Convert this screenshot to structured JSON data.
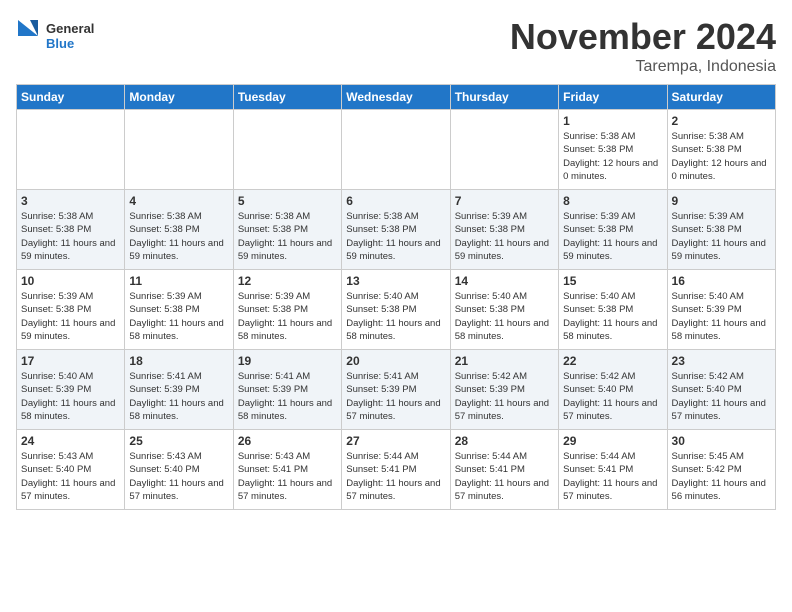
{
  "header": {
    "logo_line1": "General",
    "logo_line2": "Blue",
    "month_title": "November 2024",
    "location": "Tarempa, Indonesia"
  },
  "days_of_week": [
    "Sunday",
    "Monday",
    "Tuesday",
    "Wednesday",
    "Thursday",
    "Friday",
    "Saturday"
  ],
  "weeks": [
    [
      {
        "day": "",
        "info": ""
      },
      {
        "day": "",
        "info": ""
      },
      {
        "day": "",
        "info": ""
      },
      {
        "day": "",
        "info": ""
      },
      {
        "day": "",
        "info": ""
      },
      {
        "day": "1",
        "info": "Sunrise: 5:38 AM\nSunset: 5:38 PM\nDaylight: 12 hours and 0 minutes."
      },
      {
        "day": "2",
        "info": "Sunrise: 5:38 AM\nSunset: 5:38 PM\nDaylight: 12 hours and 0 minutes."
      }
    ],
    [
      {
        "day": "3",
        "info": "Sunrise: 5:38 AM\nSunset: 5:38 PM\nDaylight: 11 hours and 59 minutes."
      },
      {
        "day": "4",
        "info": "Sunrise: 5:38 AM\nSunset: 5:38 PM\nDaylight: 11 hours and 59 minutes."
      },
      {
        "day": "5",
        "info": "Sunrise: 5:38 AM\nSunset: 5:38 PM\nDaylight: 11 hours and 59 minutes."
      },
      {
        "day": "6",
        "info": "Sunrise: 5:38 AM\nSunset: 5:38 PM\nDaylight: 11 hours and 59 minutes."
      },
      {
        "day": "7",
        "info": "Sunrise: 5:39 AM\nSunset: 5:38 PM\nDaylight: 11 hours and 59 minutes."
      },
      {
        "day": "8",
        "info": "Sunrise: 5:39 AM\nSunset: 5:38 PM\nDaylight: 11 hours and 59 minutes."
      },
      {
        "day": "9",
        "info": "Sunrise: 5:39 AM\nSunset: 5:38 PM\nDaylight: 11 hours and 59 minutes."
      }
    ],
    [
      {
        "day": "10",
        "info": "Sunrise: 5:39 AM\nSunset: 5:38 PM\nDaylight: 11 hours and 59 minutes."
      },
      {
        "day": "11",
        "info": "Sunrise: 5:39 AM\nSunset: 5:38 PM\nDaylight: 11 hours and 58 minutes."
      },
      {
        "day": "12",
        "info": "Sunrise: 5:39 AM\nSunset: 5:38 PM\nDaylight: 11 hours and 58 minutes."
      },
      {
        "day": "13",
        "info": "Sunrise: 5:40 AM\nSunset: 5:38 PM\nDaylight: 11 hours and 58 minutes."
      },
      {
        "day": "14",
        "info": "Sunrise: 5:40 AM\nSunset: 5:38 PM\nDaylight: 11 hours and 58 minutes."
      },
      {
        "day": "15",
        "info": "Sunrise: 5:40 AM\nSunset: 5:38 PM\nDaylight: 11 hours and 58 minutes."
      },
      {
        "day": "16",
        "info": "Sunrise: 5:40 AM\nSunset: 5:39 PM\nDaylight: 11 hours and 58 minutes."
      }
    ],
    [
      {
        "day": "17",
        "info": "Sunrise: 5:40 AM\nSunset: 5:39 PM\nDaylight: 11 hours and 58 minutes."
      },
      {
        "day": "18",
        "info": "Sunrise: 5:41 AM\nSunset: 5:39 PM\nDaylight: 11 hours and 58 minutes."
      },
      {
        "day": "19",
        "info": "Sunrise: 5:41 AM\nSunset: 5:39 PM\nDaylight: 11 hours and 58 minutes."
      },
      {
        "day": "20",
        "info": "Sunrise: 5:41 AM\nSunset: 5:39 PM\nDaylight: 11 hours and 57 minutes."
      },
      {
        "day": "21",
        "info": "Sunrise: 5:42 AM\nSunset: 5:39 PM\nDaylight: 11 hours and 57 minutes."
      },
      {
        "day": "22",
        "info": "Sunrise: 5:42 AM\nSunset: 5:40 PM\nDaylight: 11 hours and 57 minutes."
      },
      {
        "day": "23",
        "info": "Sunrise: 5:42 AM\nSunset: 5:40 PM\nDaylight: 11 hours and 57 minutes."
      }
    ],
    [
      {
        "day": "24",
        "info": "Sunrise: 5:43 AM\nSunset: 5:40 PM\nDaylight: 11 hours and 57 minutes."
      },
      {
        "day": "25",
        "info": "Sunrise: 5:43 AM\nSunset: 5:40 PM\nDaylight: 11 hours and 57 minutes."
      },
      {
        "day": "26",
        "info": "Sunrise: 5:43 AM\nSunset: 5:41 PM\nDaylight: 11 hours and 57 minutes."
      },
      {
        "day": "27",
        "info": "Sunrise: 5:44 AM\nSunset: 5:41 PM\nDaylight: 11 hours and 57 minutes."
      },
      {
        "day": "28",
        "info": "Sunrise: 5:44 AM\nSunset: 5:41 PM\nDaylight: 11 hours and 57 minutes."
      },
      {
        "day": "29",
        "info": "Sunrise: 5:44 AM\nSunset: 5:41 PM\nDaylight: 11 hours and 57 minutes."
      },
      {
        "day": "30",
        "info": "Sunrise: 5:45 AM\nSunset: 5:42 PM\nDaylight: 11 hours and 56 minutes."
      }
    ]
  ]
}
